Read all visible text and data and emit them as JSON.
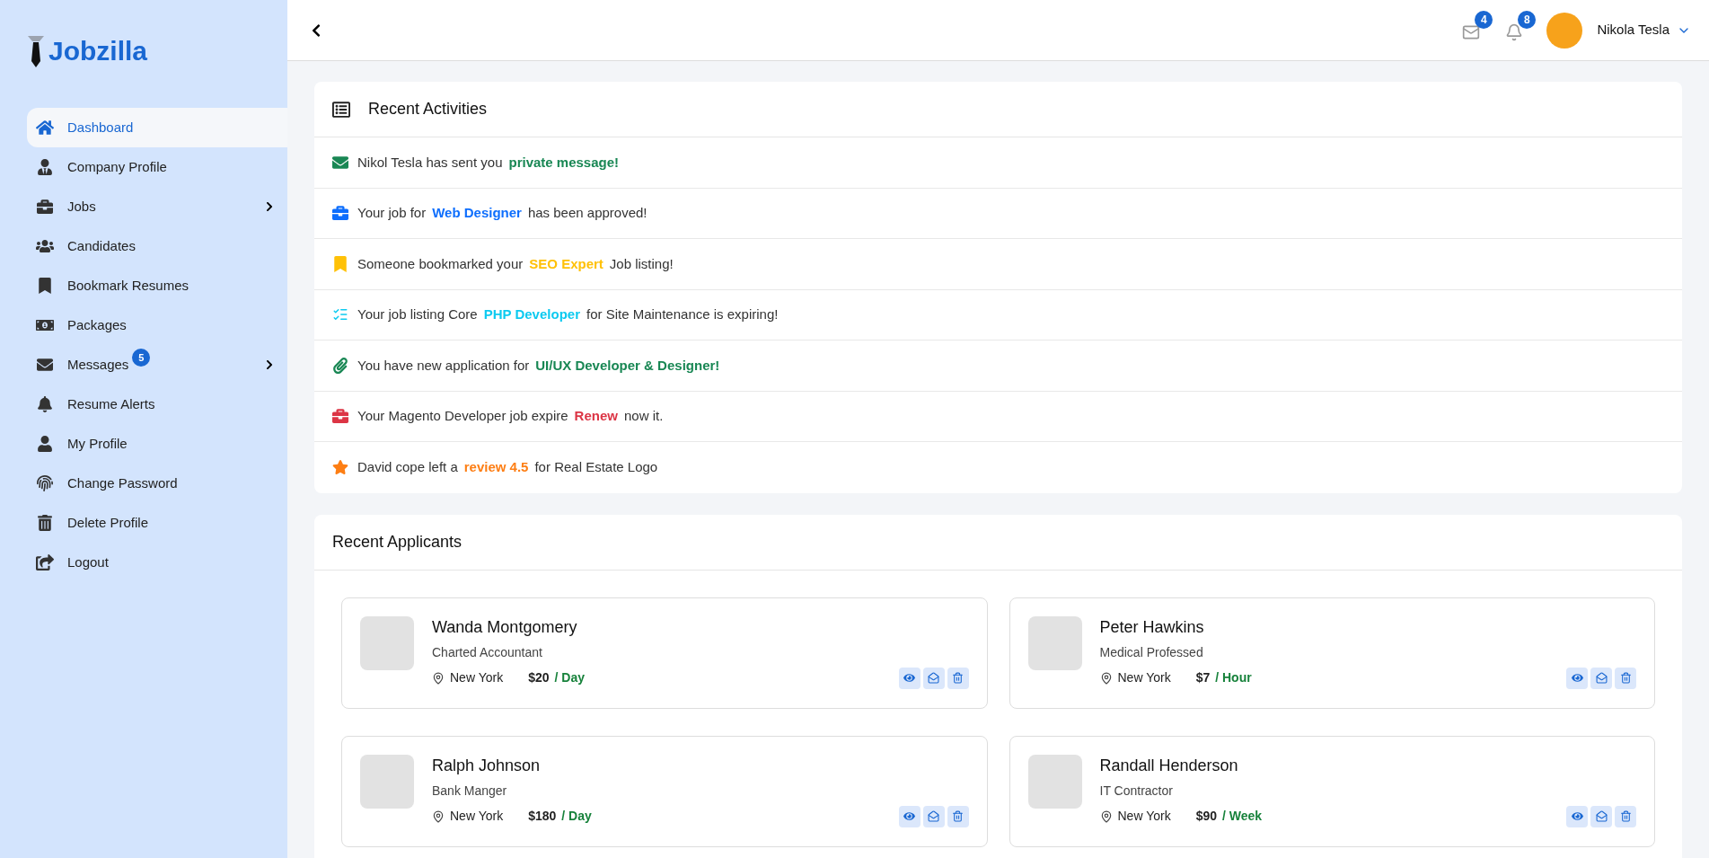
{
  "brand": {
    "logo_text": "Jobzilla"
  },
  "sidebar": {
    "items": [
      {
        "kind": "home",
        "label": "Dashboard",
        "selected": true,
        "expandable": false
      },
      {
        "kind": "user-tie",
        "label": "Company Profile",
        "selected": false,
        "expandable": false
      },
      {
        "kind": "briefcase",
        "label": "Jobs",
        "selected": false,
        "expandable": true
      },
      {
        "kind": "users",
        "label": "Candidates",
        "selected": false,
        "expandable": false
      },
      {
        "kind": "bookmark",
        "label": "Bookmark Resumes",
        "selected": false,
        "expandable": false
      },
      {
        "kind": "money",
        "label": "Packages",
        "selected": false,
        "expandable": false
      },
      {
        "kind": "envelope",
        "label": "Messages",
        "badge": "5",
        "selected": false,
        "expandable": true
      },
      {
        "kind": "bell",
        "label": "Resume Alerts",
        "selected": false,
        "expandable": false
      },
      {
        "kind": "user",
        "label": "My Profile",
        "selected": false,
        "expandable": false
      },
      {
        "kind": "fingerprint",
        "label": "Change Password",
        "selected": false,
        "expandable": false
      },
      {
        "kind": "trash",
        "label": "Delete Profile",
        "selected": false,
        "expandable": false
      },
      {
        "kind": "logout",
        "label": "Logout",
        "selected": false,
        "expandable": false
      }
    ]
  },
  "header": {
    "messages_count": "4",
    "notifications_count": "8",
    "user_name": "Nikola Tesla"
  },
  "recent_activities": {
    "title": "Recent Activities",
    "items": [
      {
        "kind": "envelope",
        "color": "#198754",
        "before": "Nikol Tesla has sent you",
        "highlight": "private message!"
      },
      {
        "kind": "briefcase",
        "color": "#0d6efd",
        "before": "Your job for",
        "highlight": "Web Designer",
        "after": "has been approved!"
      },
      {
        "kind": "bookmark",
        "color": "#ffc107",
        "before": "Someone bookmarked your",
        "highlight": "SEO Expert",
        "after": "Job listing!"
      },
      {
        "kind": "list",
        "color": "#0dcaf0",
        "before": "Your job listing Core",
        "highlight": "PHP Developer",
        "after": "for Site Maintenance is expiring!"
      },
      {
        "kind": "paperclip",
        "color": "#198754",
        "before": "You have new application for",
        "highlight": "UI/UX Developer & Designer!"
      },
      {
        "kind": "briefcase",
        "color": "#dc3545",
        "before": "Your Magento Developer job expire",
        "highlight": "Renew",
        "after": "now it."
      },
      {
        "kind": "star",
        "color": "#fd7e14",
        "before": "David cope left a",
        "highlight": "review 4.5",
        "after": "for Real Estate Logo"
      }
    ]
  },
  "recent_applicants": {
    "title": "Recent Applicants",
    "items": [
      {
        "name": "Wanda Montgomery",
        "role": "Charted Accountant",
        "location": "New York",
        "rate": "$20",
        "period": "/ Day"
      },
      {
        "name": "Peter Hawkins",
        "role": "Medical Professed",
        "location": "New York",
        "rate": "$7",
        "period": "/ Hour"
      },
      {
        "name": "Ralph Johnson",
        "role": "Bank Manger",
        "location": "New York",
        "rate": "$180",
        "period": "/ Day"
      },
      {
        "name": "Randall Henderson",
        "role": "IT Contractor",
        "location": "New York",
        "rate": "$90",
        "period": "/ Week"
      }
    ]
  }
}
